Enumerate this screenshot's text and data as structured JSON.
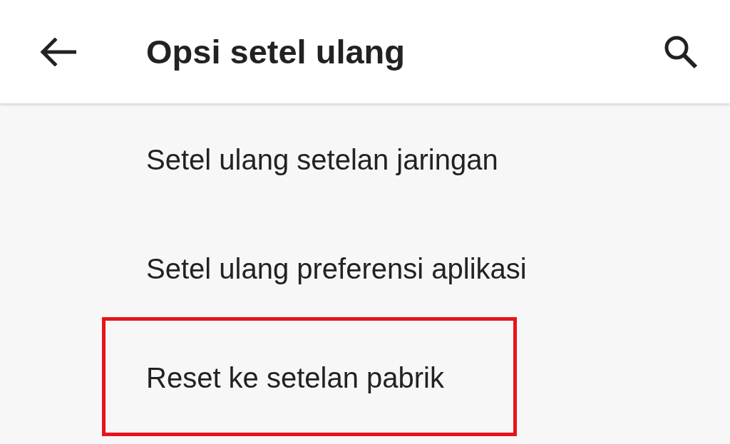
{
  "app_bar": {
    "title": "Opsi setel ulang"
  },
  "items": [
    {
      "label": "Setel ulang setelan jaringan",
      "highlighted": false
    },
    {
      "label": "Setel ulang preferensi aplikasi",
      "highlighted": false
    },
    {
      "label": "Reset ke setelan pabrik",
      "highlighted": true
    }
  ]
}
